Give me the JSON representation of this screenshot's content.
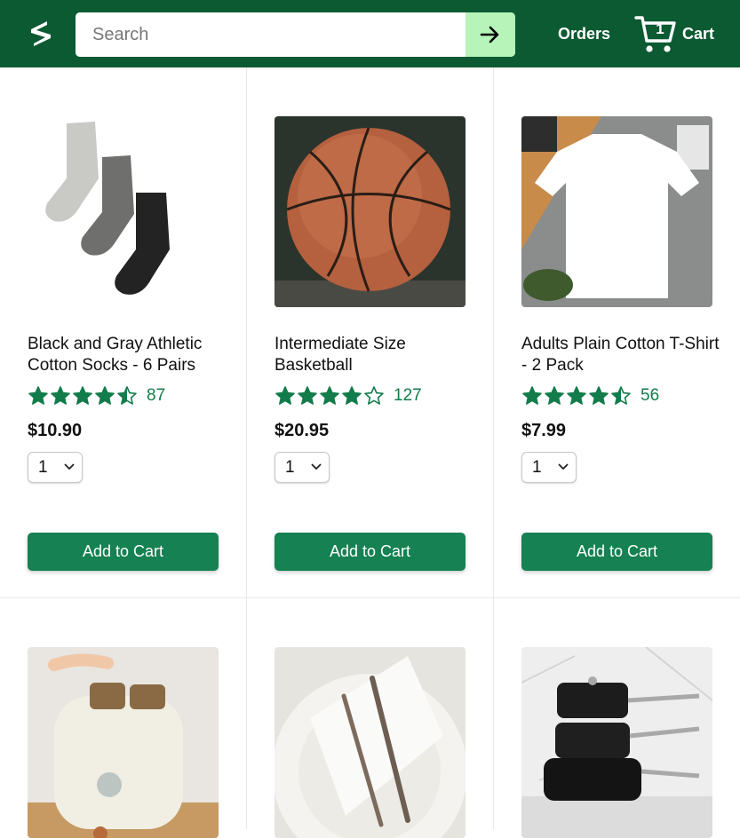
{
  "header": {
    "search_placeholder": "Search",
    "orders_label": "Orders",
    "cart_count": "1",
    "cart_label": "Cart"
  },
  "colors": {
    "header_bg": "#0b5a32",
    "search_button_bg": "#b6f4b9",
    "add_button_bg": "#168152",
    "star_color": "#127c4b"
  },
  "products": [
    {
      "title": "Black and Gray Athletic Cotton Socks - 6 Pairs",
      "rating": 4.5,
      "rating_count": "87",
      "price": "$10.90",
      "quantity": "1",
      "button_label": "Add to Cart",
      "image_icon": "socks"
    },
    {
      "title": "Intermediate Size Basketball",
      "rating": 4,
      "rating_count": "127",
      "price": "$20.95",
      "quantity": "1",
      "button_label": "Add to Cart",
      "image_icon": "basketball"
    },
    {
      "title": "Adults Plain Cotton T-Shirt - 2 Pack",
      "rating": 4.5,
      "rating_count": "56",
      "price": "$7.99",
      "quantity": "1",
      "button_label": "Add to Cart",
      "image_icon": "t-shirt"
    },
    {
      "image_icon": "toaster"
    },
    {
      "image_icon": "plate-cutlery"
    },
    {
      "image_icon": "cookware"
    }
  ]
}
